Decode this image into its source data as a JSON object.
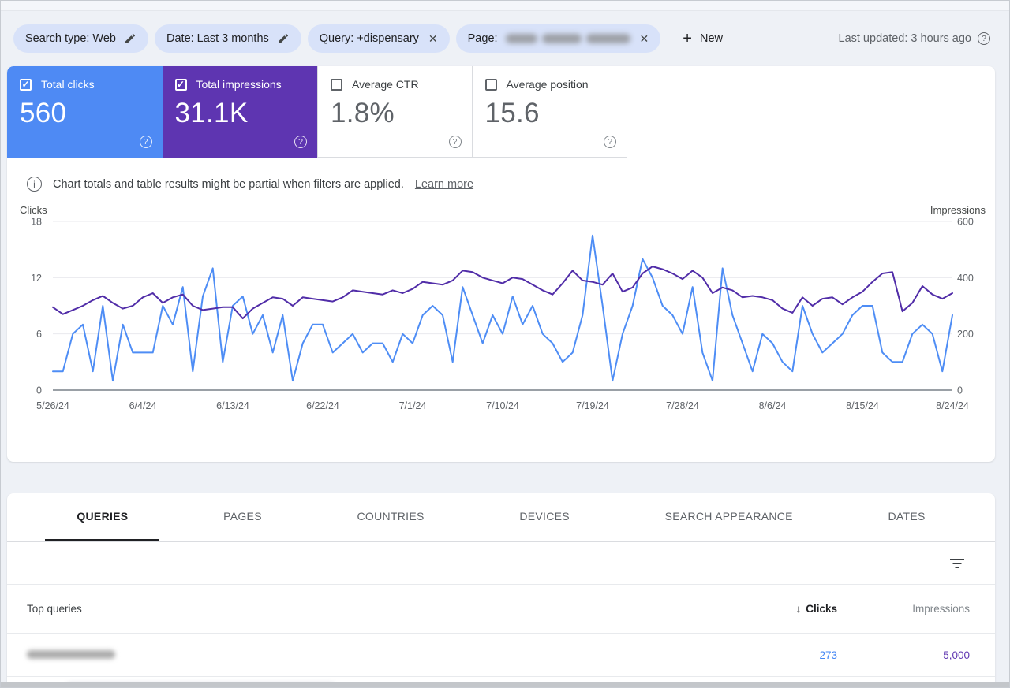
{
  "icons": {
    "help": "?",
    "info": "i",
    "close": "✕",
    "plus": "+",
    "arrow_down": "↓",
    "check": "✓"
  },
  "colors": {
    "page_background": "#eef1f6",
    "chip_background": "#d8e2f9",
    "clicks_blue": "#4e8af4",
    "impressions_purple": "#5e35b1",
    "clicks_line": "#4e8df5",
    "impressions_line": "#512da8",
    "table_clicks_value": "#4285f4",
    "table_impressions_value": "#5e35b1",
    "active_tab": "#202124",
    "muted_text": "#5f6368"
  },
  "filters": {
    "chips": [
      {
        "label": "Search type: Web",
        "action": "edit"
      },
      {
        "label": "Date: Last 3 months",
        "action": "edit"
      },
      {
        "label": "Query: +dispensary",
        "action": "remove"
      },
      {
        "label": "Page:",
        "action": "remove",
        "value_redacted": true
      }
    ],
    "new_label": "New",
    "last_updated": "Last updated: 3 hours ago"
  },
  "metric_cards": [
    {
      "label": "Total clicks",
      "value": "560",
      "checked": true,
      "bg": "#4e8af4"
    },
    {
      "label": "Total impressions",
      "value": "31.1K",
      "checked": true,
      "bg": "#5e35b1"
    },
    {
      "label": "Average CTR",
      "value": "1.8%",
      "checked": false,
      "bg": "#ffffff"
    },
    {
      "label": "Average position",
      "value": "15.6",
      "checked": false,
      "bg": "#ffffff"
    }
  ],
  "notice": {
    "text": "Chart totals and table results might be partial when filters are applied.",
    "link_label": "Learn more"
  },
  "chart_data": {
    "type": "line",
    "title": "",
    "grid": true,
    "legend_position": "none",
    "num_points": 91,
    "x_tick_labels": [
      "5/26/24",
      "6/4/24",
      "6/13/24",
      "6/22/24",
      "7/1/24",
      "7/10/24",
      "7/19/24",
      "7/28/24",
      "8/6/24",
      "8/15/24",
      "8/24/24"
    ],
    "x_tick_indices": [
      0,
      9,
      18,
      27,
      36,
      45,
      54,
      63,
      72,
      81,
      90
    ],
    "left_axis": {
      "title": "Clicks",
      "ticks": [
        0,
        6,
        12,
        18
      ],
      "max": 18
    },
    "right_axis": {
      "title": "Impressions",
      "ticks": [
        0,
        200,
        400,
        600
      ],
      "max": 600
    },
    "series": [
      {
        "name": "Clicks",
        "axis": "left",
        "color": "#4e8df5",
        "values": [
          2,
          2,
          6,
          7,
          2,
          9,
          1,
          7,
          4,
          4,
          4,
          9,
          7,
          11,
          2,
          10,
          13,
          3,
          9,
          10,
          6,
          8,
          4,
          8,
          1,
          5,
          7,
          7,
          4,
          5,
          6,
          4,
          5,
          5,
          3,
          6,
          5,
          8,
          9,
          8,
          3,
          11,
          8,
          5,
          8,
          6,
          10,
          7,
          9,
          6,
          5,
          3,
          4,
          8,
          16.5,
          9,
          1,
          6,
          9,
          14,
          12,
          9,
          8,
          6,
          11,
          4,
          1,
          13,
          8,
          5,
          2,
          6,
          5,
          3,
          2,
          9,
          6,
          4,
          5,
          6,
          8,
          9,
          9,
          4,
          3,
          3,
          6,
          7,
          6,
          2,
          8
        ]
      },
      {
        "name": "Impressions",
        "axis": "right",
        "color": "#512da8",
        "values": [
          295,
          270,
          285,
          300,
          320,
          335,
          310,
          290,
          300,
          330,
          345,
          310,
          330,
          340,
          300,
          285,
          290,
          295,
          295,
          255,
          290,
          310,
          330,
          325,
          300,
          330,
          325,
          320,
          315,
          330,
          355,
          350,
          345,
          340,
          355,
          345,
          360,
          385,
          380,
          375,
          390,
          425,
          420,
          400,
          390,
          380,
          400,
          395,
          375,
          355,
          340,
          380,
          425,
          390,
          385,
          375,
          415,
          350,
          365,
          415,
          440,
          430,
          415,
          395,
          425,
          400,
          345,
          365,
          355,
          330,
          335,
          330,
          320,
          290,
          275,
          330,
          300,
          325,
          330,
          305,
          330,
          350,
          385,
          415,
          420,
          280,
          310,
          370,
          340,
          325,
          345
        ]
      }
    ]
  },
  "tabs": [
    {
      "label": "QUERIES",
      "active": true
    },
    {
      "label": "PAGES",
      "active": false
    },
    {
      "label": "COUNTRIES",
      "active": false
    },
    {
      "label": "DEVICES",
      "active": false
    },
    {
      "label": "SEARCH APPEARANCE",
      "active": false
    },
    {
      "label": "DATES",
      "active": false
    }
  ],
  "table": {
    "first_col_header": "Top queries",
    "sorted_by": "Clicks",
    "clicks_header": "Clicks",
    "impressions_header": "Impressions",
    "rows": [
      {
        "query_redacted": true,
        "clicks": "273",
        "impressions": "5,000"
      }
    ]
  }
}
